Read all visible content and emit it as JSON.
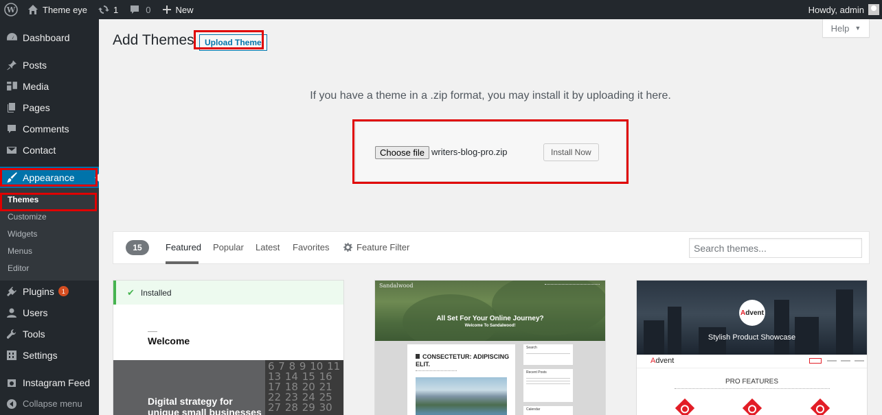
{
  "admin_bar": {
    "site_name": "Theme eye",
    "updates_count": "1",
    "comments_count": "0",
    "new_label": "New",
    "greeting": "Howdy, admin"
  },
  "sidebar": {
    "items": [
      {
        "label": "Dashboard",
        "icon": "dashboard-icon"
      },
      {
        "label": "Posts",
        "icon": "pin-icon"
      },
      {
        "label": "Media",
        "icon": "media-icon"
      },
      {
        "label": "Pages",
        "icon": "pages-icon"
      },
      {
        "label": "Comments",
        "icon": "comment-icon"
      },
      {
        "label": "Contact",
        "icon": "mail-icon"
      },
      {
        "label": "Appearance",
        "icon": "brush-icon"
      },
      {
        "label": "Plugins",
        "icon": "plug-icon",
        "badge": "1"
      },
      {
        "label": "Users",
        "icon": "user-icon"
      },
      {
        "label": "Tools",
        "icon": "wrench-icon"
      },
      {
        "label": "Settings",
        "icon": "settings-icon"
      },
      {
        "label": "Instagram Feed",
        "icon": "camera-icon"
      },
      {
        "label": "Collapse menu",
        "icon": "collapse-icon"
      }
    ],
    "appearance_submenu": [
      "Themes",
      "Customize",
      "Widgets",
      "Menus",
      "Editor"
    ]
  },
  "page": {
    "title": "Add Themes",
    "upload_button": "Upload Theme",
    "help_label": "Help",
    "upload_text": "If you have a theme in a .zip format, you may install it by uploading it here.",
    "choose_file_label": "Choose file",
    "selected_file": "writers-blog-pro.zip",
    "install_button": "Install Now"
  },
  "filter": {
    "count": "15",
    "tabs": [
      "Featured",
      "Popular",
      "Latest",
      "Favorites"
    ],
    "feature_filter": "Feature Filter",
    "search_placeholder": "Search themes..."
  },
  "themes": {
    "card1": {
      "installed_label": "Installed",
      "welcome": "Welcome",
      "tagline_line1": "Digital strategy for",
      "tagline_line2": "unique small businesses",
      "calendar": "6 7 8 9 10 11 13 14 15 16 17 18 20 21 22 23 24 25 27 28 29 30"
    },
    "card2": {
      "logo": "Sandalwood",
      "hero_title": "All Set For Your Online Journey?",
      "hero_sub": "Welcome To Sandalwood!",
      "post_title": "CONSECTETUR: ADIPISCING ELIT.",
      "search_label": "Search",
      "recent_posts_label": "Recent Posts",
      "calendar_label": "Calendar"
    },
    "card3": {
      "logo_letter": "A",
      "logo_rest": "dvent",
      "tagline": "Stylish Product Showcase",
      "nav_brand_letter": "A",
      "nav_brand_rest": "dvent",
      "pro_features": "PRO FEATURES"
    }
  },
  "colors": {
    "admin_dark": "#23282d",
    "accent_blue": "#0073aa",
    "highlight_red": "#e00000",
    "installed_green": "#46b450"
  }
}
